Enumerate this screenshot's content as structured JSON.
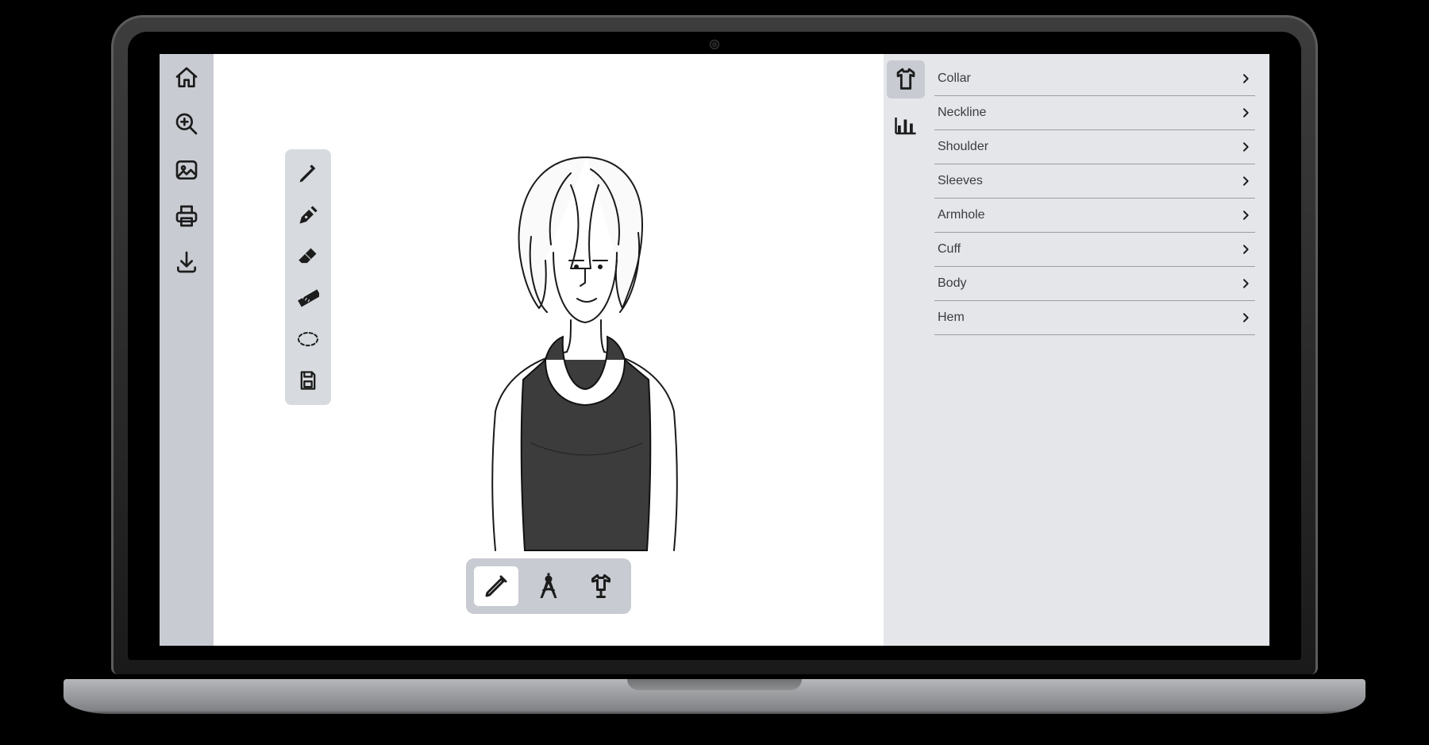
{
  "left_rail": [
    {
      "id": "home",
      "icon": "home"
    },
    {
      "id": "zoom",
      "icon": "zoom-in"
    },
    {
      "id": "image",
      "icon": "picture"
    },
    {
      "id": "print",
      "icon": "printer"
    },
    {
      "id": "download",
      "icon": "download"
    }
  ],
  "float_tools": [
    {
      "id": "pencil",
      "icon": "pencil"
    },
    {
      "id": "pen",
      "icon": "pen-nib"
    },
    {
      "id": "eraser",
      "icon": "eraser"
    },
    {
      "id": "ruler",
      "icon": "ruler"
    },
    {
      "id": "lasso",
      "icon": "lasso"
    },
    {
      "id": "save",
      "icon": "save"
    }
  ],
  "bottom_modes": [
    {
      "id": "sketch",
      "icon": "pencil-outline",
      "active": true
    },
    {
      "id": "measure",
      "icon": "compass",
      "active": false
    },
    {
      "id": "garment",
      "icon": "mannequin",
      "active": false
    }
  ],
  "right_tabs": [
    {
      "id": "garment",
      "icon": "tshirt",
      "active": true
    },
    {
      "id": "stats",
      "icon": "bar-chart",
      "active": false
    }
  ],
  "accordion": [
    {
      "label": "Collar"
    },
    {
      "label": "Neckline"
    },
    {
      "label": "Shoulder"
    },
    {
      "label": "Sleeves"
    },
    {
      "label": "Armhole"
    },
    {
      "label": "Cuff"
    },
    {
      "label": "Body"
    },
    {
      "label": "Hem"
    }
  ]
}
